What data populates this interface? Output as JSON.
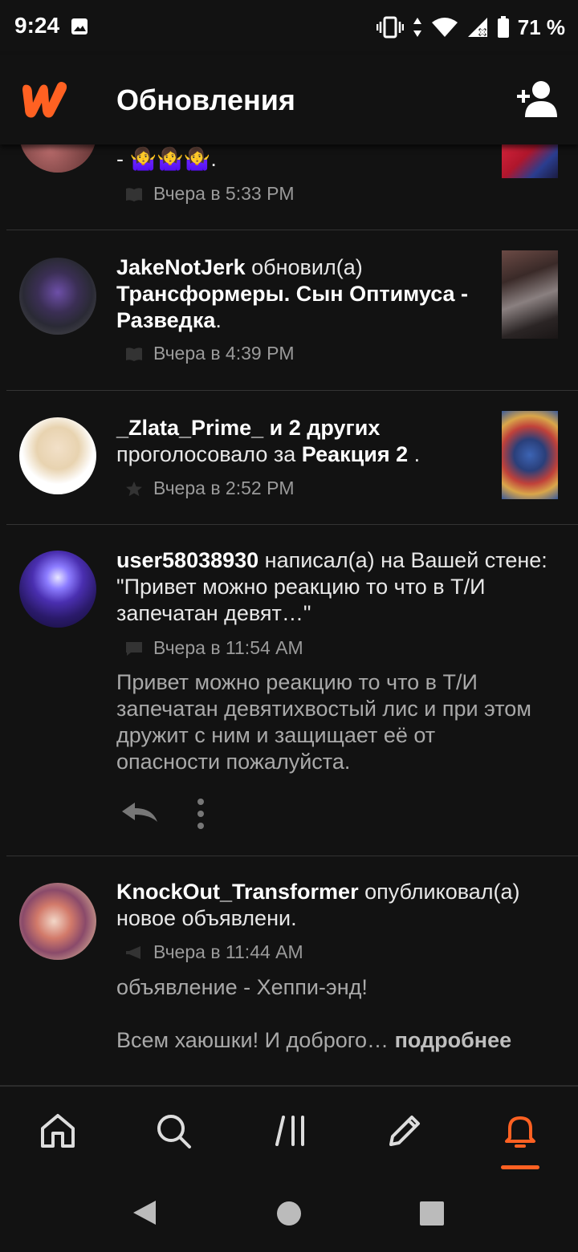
{
  "status_bar": {
    "time": "9:24",
    "battery_text": "71 %",
    "icons": [
      "gallery-icon",
      "vibrate-icon",
      "data-arrows-icon",
      "wifi-icon",
      "signal-icon",
      "battery-icon"
    ]
  },
  "app_bar": {
    "title": "Обновления",
    "logo_icon": "wattpad-logo",
    "action_icon": "add-user-icon"
  },
  "feed": {
    "items": [
      {
        "partial_text": "- 🤷‍♀️🤷‍♀️🤷‍♀️.",
        "time": "Вчера в 5:33 PM",
        "meta_icon": "book-icon"
      },
      {
        "user": "JakeNotJerk",
        "action": " обновил(а) ",
        "target": "Трансформеры. Сын Оптимуса - Разведка",
        "suffix": ".",
        "time": "Вчера в 4:39 PM",
        "meta_icon": "book-icon"
      },
      {
        "user": "_Zlata_Prime_ и 2 других",
        "action": "проголосовало за ",
        "target": "Реакция 2",
        "suffix": " .",
        "time": "Вчера в 2:52 PM",
        "meta_icon": "star-icon"
      },
      {
        "user": "user58038930",
        "action": " написал(а) на Вашей стене: ",
        "quote": "\"Привет можно реакцию то что в Т/И запечатан девят…\"",
        "time": "Вчера в 11:54 AM",
        "meta_icon": "comment-icon",
        "body": "Привет можно реакцию то что в Т/И запечатан девятихвостый лис и при этом дружит с ним и защищает её от опасности пожалуйста."
      },
      {
        "user": "KnockOut_Transformer",
        "action": " опубликовал(а) новое объявлени.",
        "time": "Вчера в 11:44 AM",
        "meta_icon": "megaphone-icon",
        "body_line1": "объявление - Хеппи-энд!",
        "body_line2": "Всем хаюшки! И доброго… ",
        "more": "подробнее"
      }
    ]
  },
  "bottom_nav": {
    "items": [
      "home-icon",
      "search-icon",
      "library-icon",
      "write-icon",
      "notifications-icon"
    ],
    "active": "notifications-icon",
    "accent": "#ff6122"
  }
}
